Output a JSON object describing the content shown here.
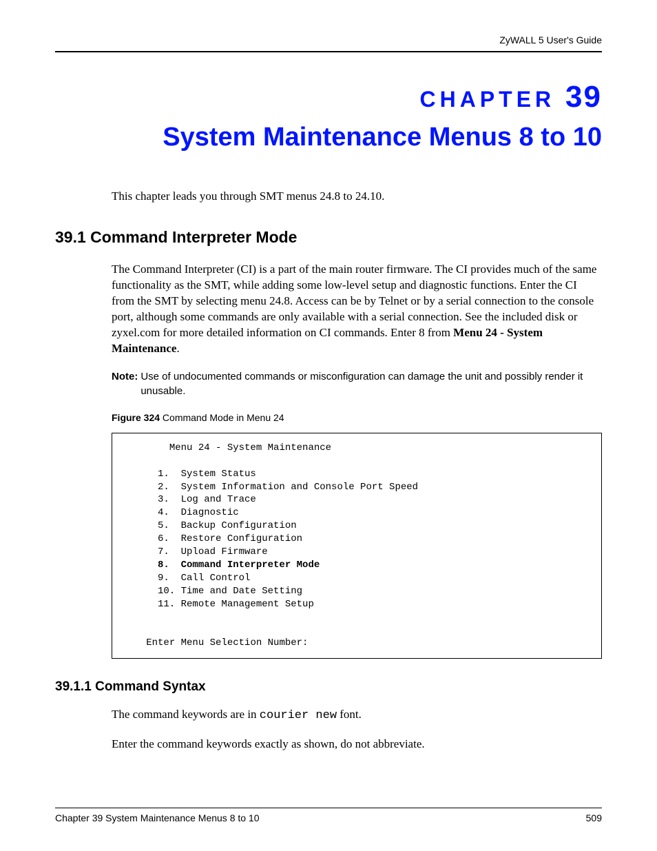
{
  "header": {
    "guide": "ZyWALL 5 User's Guide"
  },
  "chapter": {
    "label_word": "CHAPTER",
    "number": "39",
    "title": "System Maintenance Menus 8 to 10"
  },
  "intro": "This chapter leads you through SMT menus 24.8 to 24.10.",
  "section1": {
    "heading": "39.1  Command Interpreter Mode",
    "para_part1": "The Command Interpreter (CI) is a part of the main router firmware. The CI provides much of the same functionality as the SMT, while adding some low-level setup and diagnostic functions. Enter the CI from the SMT by selecting menu 24.8. Access can be by Telnet or by a serial connection to the console port, although some commands are only available with a serial connection. See the included disk or zyxel.com for more detailed information on CI commands. Enter 8 from ",
    "para_bold": "Menu 24 - System Maintenance",
    "para_part2": "."
  },
  "note": {
    "label": "Note:",
    "text": "Use of undocumented commands or misconfiguration can damage the unit and possibly render it unusable."
  },
  "figure": {
    "label": "Figure 324",
    "caption": "   Command Mode in Menu 24"
  },
  "menu": {
    "title": "Menu 24 - System Maintenance",
    "items_pre": "     1.  System Status\n     2.  System Information and Console Port Speed\n     3.  Log and Trace\n     4.  Diagnostic\n     5.  Backup Configuration\n     6.  Restore Configuration\n     7.  Upload Firmware",
    "item_bold": "     8.  Command Interpreter Mode",
    "items_post": "     9.  Call Control\n     10. Time and Date Setting\n     11. Remote Management Setup",
    "prompt": "Enter Menu Selection Number:"
  },
  "section1_1": {
    "heading": "39.1.1  Command Syntax",
    "p1_a": "The command keywords are in ",
    "p1_mono": "courier new",
    "p1_b": " font.",
    "p2": "Enter the command keywords exactly as shown, do not abbreviate."
  },
  "footer": {
    "left": "Chapter 39 System Maintenance Menus 8 to 10",
    "right": "509"
  }
}
